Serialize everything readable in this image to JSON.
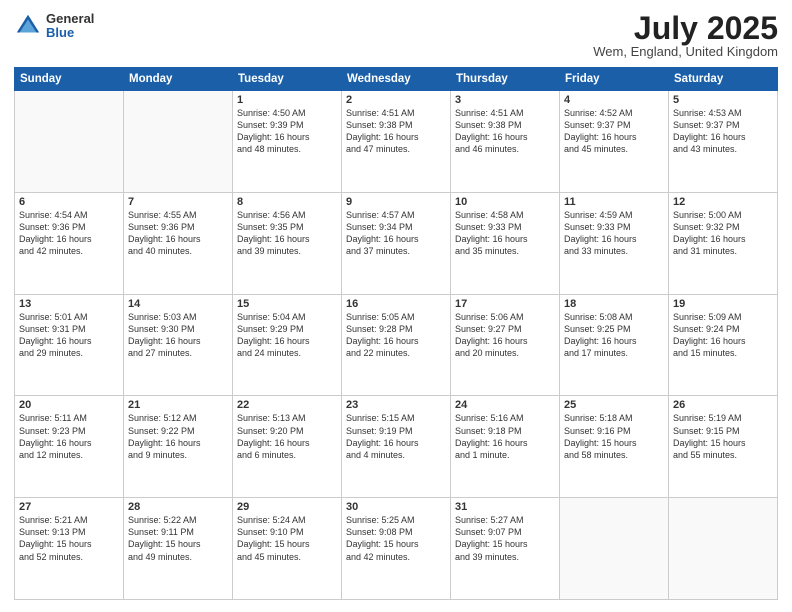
{
  "header": {
    "logo_general": "General",
    "logo_blue": "Blue",
    "month": "July 2025",
    "location": "Wem, England, United Kingdom"
  },
  "days_of_week": [
    "Sunday",
    "Monday",
    "Tuesday",
    "Wednesday",
    "Thursday",
    "Friday",
    "Saturday"
  ],
  "weeks": [
    [
      {
        "num": "",
        "info": ""
      },
      {
        "num": "",
        "info": ""
      },
      {
        "num": "1",
        "info": "Sunrise: 4:50 AM\nSunset: 9:39 PM\nDaylight: 16 hours\nand 48 minutes."
      },
      {
        "num": "2",
        "info": "Sunrise: 4:51 AM\nSunset: 9:38 PM\nDaylight: 16 hours\nand 47 minutes."
      },
      {
        "num": "3",
        "info": "Sunrise: 4:51 AM\nSunset: 9:38 PM\nDaylight: 16 hours\nand 46 minutes."
      },
      {
        "num": "4",
        "info": "Sunrise: 4:52 AM\nSunset: 9:37 PM\nDaylight: 16 hours\nand 45 minutes."
      },
      {
        "num": "5",
        "info": "Sunrise: 4:53 AM\nSunset: 9:37 PM\nDaylight: 16 hours\nand 43 minutes."
      }
    ],
    [
      {
        "num": "6",
        "info": "Sunrise: 4:54 AM\nSunset: 9:36 PM\nDaylight: 16 hours\nand 42 minutes."
      },
      {
        "num": "7",
        "info": "Sunrise: 4:55 AM\nSunset: 9:36 PM\nDaylight: 16 hours\nand 40 minutes."
      },
      {
        "num": "8",
        "info": "Sunrise: 4:56 AM\nSunset: 9:35 PM\nDaylight: 16 hours\nand 39 minutes."
      },
      {
        "num": "9",
        "info": "Sunrise: 4:57 AM\nSunset: 9:34 PM\nDaylight: 16 hours\nand 37 minutes."
      },
      {
        "num": "10",
        "info": "Sunrise: 4:58 AM\nSunset: 9:33 PM\nDaylight: 16 hours\nand 35 minutes."
      },
      {
        "num": "11",
        "info": "Sunrise: 4:59 AM\nSunset: 9:33 PM\nDaylight: 16 hours\nand 33 minutes."
      },
      {
        "num": "12",
        "info": "Sunrise: 5:00 AM\nSunset: 9:32 PM\nDaylight: 16 hours\nand 31 minutes."
      }
    ],
    [
      {
        "num": "13",
        "info": "Sunrise: 5:01 AM\nSunset: 9:31 PM\nDaylight: 16 hours\nand 29 minutes."
      },
      {
        "num": "14",
        "info": "Sunrise: 5:03 AM\nSunset: 9:30 PM\nDaylight: 16 hours\nand 27 minutes."
      },
      {
        "num": "15",
        "info": "Sunrise: 5:04 AM\nSunset: 9:29 PM\nDaylight: 16 hours\nand 24 minutes."
      },
      {
        "num": "16",
        "info": "Sunrise: 5:05 AM\nSunset: 9:28 PM\nDaylight: 16 hours\nand 22 minutes."
      },
      {
        "num": "17",
        "info": "Sunrise: 5:06 AM\nSunset: 9:27 PM\nDaylight: 16 hours\nand 20 minutes."
      },
      {
        "num": "18",
        "info": "Sunrise: 5:08 AM\nSunset: 9:25 PM\nDaylight: 16 hours\nand 17 minutes."
      },
      {
        "num": "19",
        "info": "Sunrise: 5:09 AM\nSunset: 9:24 PM\nDaylight: 16 hours\nand 15 minutes."
      }
    ],
    [
      {
        "num": "20",
        "info": "Sunrise: 5:11 AM\nSunset: 9:23 PM\nDaylight: 16 hours\nand 12 minutes."
      },
      {
        "num": "21",
        "info": "Sunrise: 5:12 AM\nSunset: 9:22 PM\nDaylight: 16 hours\nand 9 minutes."
      },
      {
        "num": "22",
        "info": "Sunrise: 5:13 AM\nSunset: 9:20 PM\nDaylight: 16 hours\nand 6 minutes."
      },
      {
        "num": "23",
        "info": "Sunrise: 5:15 AM\nSunset: 9:19 PM\nDaylight: 16 hours\nand 4 minutes."
      },
      {
        "num": "24",
        "info": "Sunrise: 5:16 AM\nSunset: 9:18 PM\nDaylight: 16 hours\nand 1 minute."
      },
      {
        "num": "25",
        "info": "Sunrise: 5:18 AM\nSunset: 9:16 PM\nDaylight: 15 hours\nand 58 minutes."
      },
      {
        "num": "26",
        "info": "Sunrise: 5:19 AM\nSunset: 9:15 PM\nDaylight: 15 hours\nand 55 minutes."
      }
    ],
    [
      {
        "num": "27",
        "info": "Sunrise: 5:21 AM\nSunset: 9:13 PM\nDaylight: 15 hours\nand 52 minutes."
      },
      {
        "num": "28",
        "info": "Sunrise: 5:22 AM\nSunset: 9:11 PM\nDaylight: 15 hours\nand 49 minutes."
      },
      {
        "num": "29",
        "info": "Sunrise: 5:24 AM\nSunset: 9:10 PM\nDaylight: 15 hours\nand 45 minutes."
      },
      {
        "num": "30",
        "info": "Sunrise: 5:25 AM\nSunset: 9:08 PM\nDaylight: 15 hours\nand 42 minutes."
      },
      {
        "num": "31",
        "info": "Sunrise: 5:27 AM\nSunset: 9:07 PM\nDaylight: 15 hours\nand 39 minutes."
      },
      {
        "num": "",
        "info": ""
      },
      {
        "num": "",
        "info": ""
      }
    ]
  ]
}
